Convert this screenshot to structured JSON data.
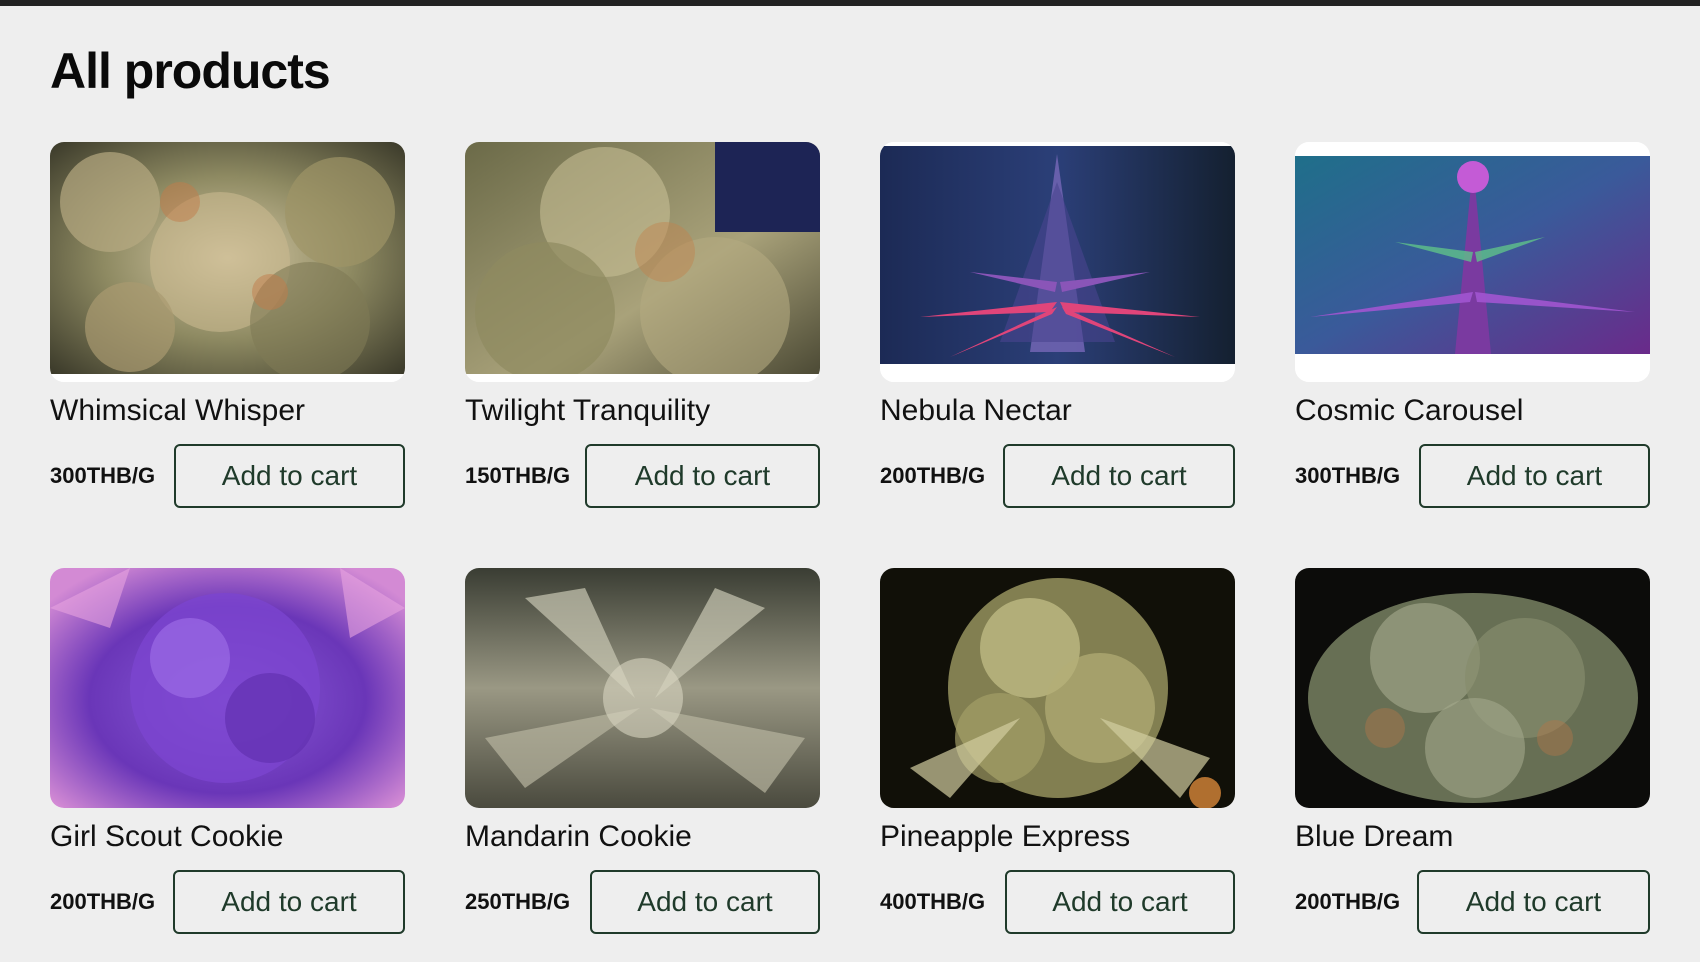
{
  "page": {
    "title": "All products"
  },
  "products": [
    {
      "name": "Whimsical Whisper",
      "price": "300THB/G",
      "button": "Add to cart",
      "image": "cannabis-bud-photo"
    },
    {
      "name": "Twilight Tranquility",
      "price": "150THB/G",
      "button": "Add to cart",
      "image": "cannabis-bud-photo"
    },
    {
      "name": "Nebula Nectar",
      "price": "200THB/G",
      "button": "Add to cart",
      "image": "cannabis-plant-photo"
    },
    {
      "name": "Cosmic Carousel",
      "price": "300THB/G",
      "button": "Add to cart",
      "image": "cannabis-plant-photo"
    },
    {
      "name": "Girl Scout Cookie",
      "price": "200THB/G",
      "button": "Add to cart",
      "image": "cannabis-bud-photo"
    },
    {
      "name": "Mandarin Cookie",
      "price": "250THB/G",
      "button": "Add to cart",
      "image": "cannabis-bud-photo"
    },
    {
      "name": "Pineapple Express",
      "price": "400THB/G",
      "button": "Add to cart",
      "image": "cannabis-bud-photo"
    },
    {
      "name": "Blue Dream",
      "price": "200THB/G",
      "button": "Add to cart",
      "image": "cannabis-bud-photo"
    }
  ],
  "colors": {
    "background": "#eeeeee",
    "button_border": "#1f3a2a",
    "button_text": "#1f3a2a",
    "top_bar": "#222222"
  }
}
